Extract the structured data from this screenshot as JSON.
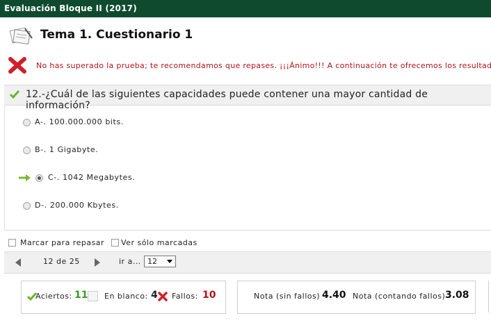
{
  "window": {
    "title": "Evaluación Bloque II (2017)"
  },
  "header": {
    "title": "Tema 1. Cuestionario 1"
  },
  "alert": {
    "message": "No has superado la prueba; te recomendamos que repases. ¡¡¡Ánimo!!! A continuación te ofrecemos los resultados"
  },
  "question": {
    "text": "12.-¿Cuál de las siguientes capacidades puede contener una mayor cantidad de información?",
    "answers": [
      {
        "label": "A-. 100.000.000 bits.",
        "selected": false
      },
      {
        "label": "B-. 1 Gigabyte.",
        "selected": false
      },
      {
        "label": "C-. 1042 Megabytes.",
        "selected": true
      },
      {
        "label": "D-. 200.000 Kbytes.",
        "selected": false
      }
    ]
  },
  "options": {
    "mark_review": "Marcar para repasar",
    "show_marked": "Ver sólo marcadas"
  },
  "navigation": {
    "position": "12 de 25",
    "goto_label": "ir a...",
    "goto_value": "12"
  },
  "stats": {
    "correct_label": "Aciertos:",
    "correct_value": "11",
    "blank_label": "En blanco:",
    "blank_value": "4",
    "fail_label": "Fallos:",
    "fail_value": "10"
  },
  "grades": {
    "no_penalty_label": "Nota (sin fallos)",
    "no_penalty_value": "4.40",
    "with_penalty_label": "Nota (contando fallos)",
    "with_penalty_value": "3.08"
  },
  "colors": {
    "titlebar": "#0f4a2f",
    "error": "#b0141a",
    "correct": "#3a9a2a",
    "check": "#6ab42a"
  }
}
